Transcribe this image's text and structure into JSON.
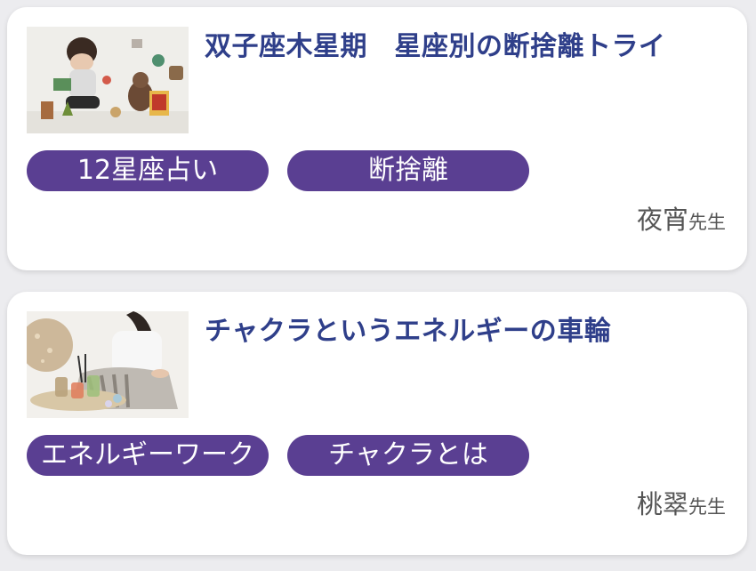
{
  "articles": [
    {
      "title": "双子座木星期　星座別の断捨離トライ",
      "tags": [
        "12星座占い",
        "断捨離"
      ],
      "author": "夜宵",
      "author_suffix": "先生",
      "thumbnail": "child-playing-with-toys-photo"
    },
    {
      "title": "チャクラというエネルギーの車輪",
      "tags": [
        "エネルギーワーク",
        "チャクラとは"
      ],
      "author": "桃翠",
      "author_suffix": "先生",
      "thumbnail": "woman-with-candles-and-crystals-photo"
    }
  ],
  "colors": {
    "title": "#2f3f8a",
    "tag_bg": "#5a3f92",
    "tag_text": "#ffffff",
    "author_text": "#555555",
    "card_bg": "#ffffff"
  }
}
